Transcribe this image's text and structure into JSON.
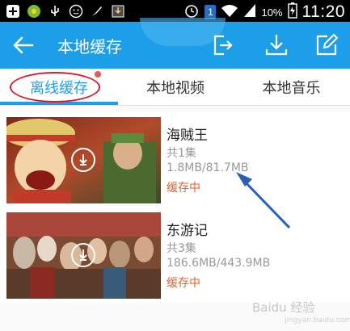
{
  "status_bar": {
    "battery_percent": "10%",
    "time": "11:20",
    "notification_badge": "1",
    "icons": [
      "plus-icon",
      "flower-icon",
      "usb-icon",
      "face-icon",
      "brush-icon",
      "download-icon",
      "alarm-icon",
      "sim-badge-icon",
      "wifi-icon",
      "signal-icon",
      "battery-icon"
    ]
  },
  "appbar": {
    "title": "本地缓存",
    "actions": [
      "export-icon",
      "download-icon",
      "edit-icon"
    ],
    "color": "#1d9ee9"
  },
  "tabs": [
    {
      "label": "离线缓存",
      "active": true
    },
    {
      "label": "本地视频",
      "active": false
    },
    {
      "label": "本地音乐",
      "active": false
    }
  ],
  "items": [
    {
      "title": "海贼王",
      "episodes": "共1集",
      "size": "1.8MB/81.7MB",
      "status": "缓存中"
    },
    {
      "title": "东游记",
      "episodes": "共3集",
      "size": "186.6MB/443.9MB",
      "status": "缓存中"
    }
  ],
  "colors": {
    "status_accent": "#e8622a",
    "annotation": "#e0192d"
  },
  "watermark": {
    "text": "Baidu 经验",
    "sub": "jingyan.baidu.com"
  }
}
